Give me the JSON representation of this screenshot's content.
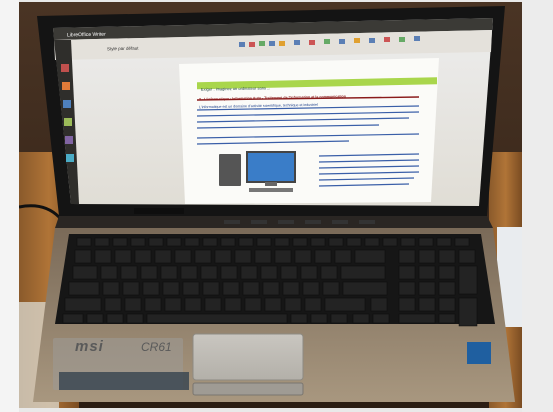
{
  "screen": {
    "window_title": "LibreOffice Writer",
    "menu_label": "Style par défaut",
    "doc_heading": "2 - L'informatique : Information Auto - Traitement de l'information et la communication",
    "highlight_line": "Exiger : imaginez un ordinateur sans ...",
    "paragraph_line": "L'informatique est un domaine d'activité scientifique, technique et industriel"
  },
  "laptop": {
    "brand": "msi",
    "model": "CR61"
  }
}
